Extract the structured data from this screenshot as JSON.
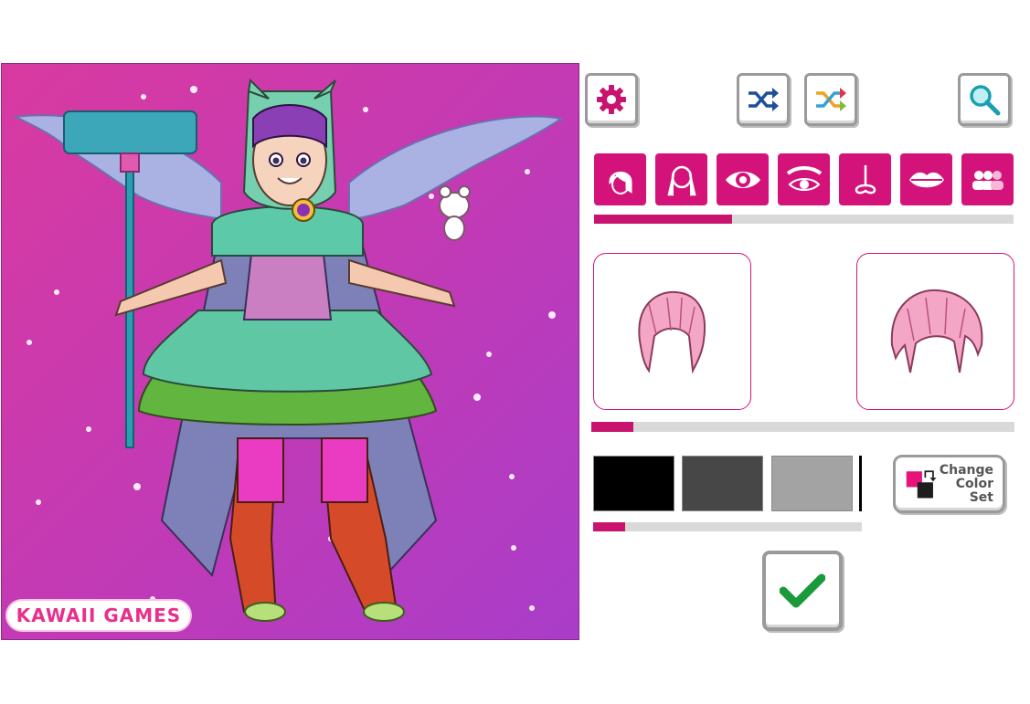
{
  "logo": {
    "text": "KAWAII GAMES"
  },
  "toolbar": {
    "settings_icon": "gear-icon",
    "random_icon": "shuffle-icon",
    "random_color_icon": "shuffle-color-icon",
    "zoom_icon": "magnifier-icon"
  },
  "category_tabs": [
    {
      "name": "hair-front",
      "icon": "hair-front-icon"
    },
    {
      "name": "hair-back",
      "icon": "hair-back-icon"
    },
    {
      "name": "eyes",
      "icon": "eye-icon"
    },
    {
      "name": "eyebrows",
      "icon": "eyebrow-icon"
    },
    {
      "name": "nose",
      "icon": "nose-icon"
    },
    {
      "name": "mouth",
      "icon": "lips-icon"
    },
    {
      "name": "group",
      "icon": "people-icon"
    }
  ],
  "category_scroll_fraction": 0.33,
  "options_scroll_fraction": 0.1,
  "colors": {
    "swatches": [
      "#000000",
      "#474747",
      "#a3a3a3"
    ],
    "scroll_fraction": 0.12,
    "accent": "#d4137a"
  },
  "change_color_set": {
    "label": "Change\nColor\nSet"
  },
  "confirm_icon": "checkmark-icon"
}
